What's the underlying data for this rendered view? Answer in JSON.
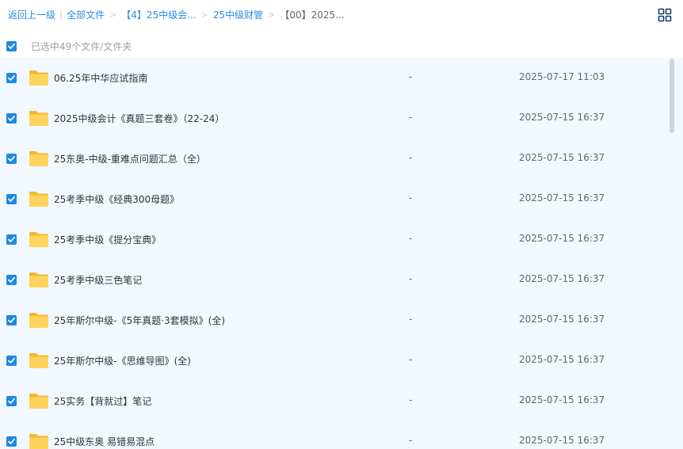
{
  "breadcrumb": {
    "back_label": "返回上一级",
    "all_files_label": "全部文件",
    "crumbs": [
      "【4】25中级会...",
      "25中级财管"
    ],
    "current": "【00】2025..."
  },
  "selection": {
    "text": "已选中49个文件/文件夹"
  },
  "files": [
    {
      "name": "06.25年中华应试指南",
      "size": "-",
      "date": "2025-07-17 11:03"
    },
    {
      "name": "2025中级会计《真题三套卷》（22-24）",
      "size": "-",
      "date": "2025-07-15 16:37"
    },
    {
      "name": "25东奥-中级-重难点问题汇总（全）",
      "size": "-",
      "date": "2025-07-15 16:37"
    },
    {
      "name": "25考季中级《经典300母题》",
      "size": "-",
      "date": "2025-07-15 16:37"
    },
    {
      "name": "25考季中级《提分宝典》",
      "size": "-",
      "date": "2025-07-15 16:37"
    },
    {
      "name": "25考季中级三色笔记",
      "size": "-",
      "date": "2025-07-15 16:37"
    },
    {
      "name": "25年斯尔中级-《5年真题·3套模拟》(全)",
      "size": "-",
      "date": "2025-07-15 16:37"
    },
    {
      "name": "25年斯尔中级-《思维导图》(全)",
      "size": "-",
      "date": "2025-07-15 16:37"
    },
    {
      "name": "25实务【背就过】笔记",
      "size": "-",
      "date": "2025-07-15 16:37"
    },
    {
      "name": "25中级东奥 易错易混点",
      "size": "-",
      "date": "2025-07-15 16:37"
    }
  ],
  "icons": {
    "folder": "folder-icon",
    "checkbox": "checkbox-checked-icon",
    "grid": "grid-view-icon"
  },
  "colors": {
    "accent": "#1e88e5",
    "link": "#2a8ce6",
    "row_selected_bg": "#f1f8ff",
    "folder_yellow": "#ffc94a"
  }
}
